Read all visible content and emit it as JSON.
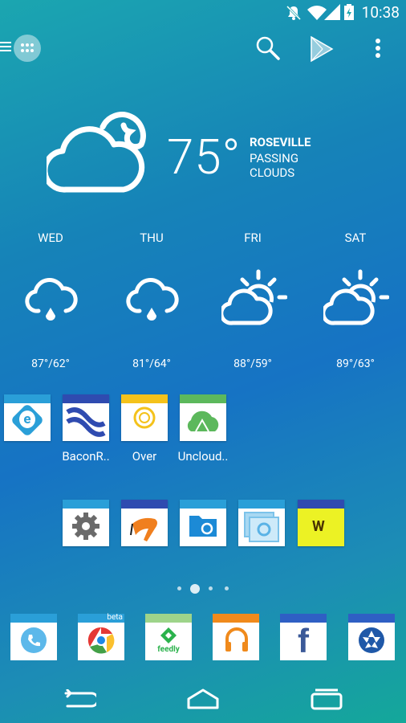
{
  "status_bar": {
    "time": "10:38"
  },
  "weather": {
    "temperature": "75°",
    "city": "ROSEVILLE",
    "condition_line1": "PASSING",
    "condition_line2": "CLOUDS",
    "forecast": [
      {
        "day": "WED",
        "temps": "87°/62°",
        "icon": "cloud-rain-icon"
      },
      {
        "day": "THU",
        "temps": "81°/64°",
        "icon": "cloud-rain-icon"
      },
      {
        "day": "FRI",
        "temps": "88°/59°",
        "icon": "partly-sunny-icon"
      },
      {
        "day": "SAT",
        "temps": "89°/63°",
        "icon": "partly-sunny-icon"
      }
    ]
  },
  "apps_row1": [
    {
      "label": "",
      "icon": "e-app-icon"
    },
    {
      "label": "BaconR..",
      "icon": "baconreader-icon"
    },
    {
      "label": "Over",
      "icon": "over-icon"
    },
    {
      "label": "Uncloud..",
      "icon": "uncloud-icon"
    }
  ],
  "apps_row2": [
    {
      "icon": "settings-gear-icon"
    },
    {
      "icon": "paint-brush-icon"
    },
    {
      "icon": "file-manager-icon"
    },
    {
      "icon": "photos-icon"
    },
    {
      "icon": "w-app-icon"
    }
  ],
  "dock": [
    {
      "icon": "phone-icon"
    },
    {
      "icon": "chrome-beta-icon",
      "badge": "beta"
    },
    {
      "icon": "feedly-icon",
      "label": "feedly"
    },
    {
      "icon": "headphones-music-icon"
    },
    {
      "icon": "facebook-icon"
    },
    {
      "icon": "camera-aperture-icon"
    }
  ],
  "colors": {
    "accent_blue": "#2a9fd8",
    "dock_band_blue": "#2f5fc4",
    "over_yellow": "#f4c21b",
    "uncloud_green": "#5cb85c"
  }
}
